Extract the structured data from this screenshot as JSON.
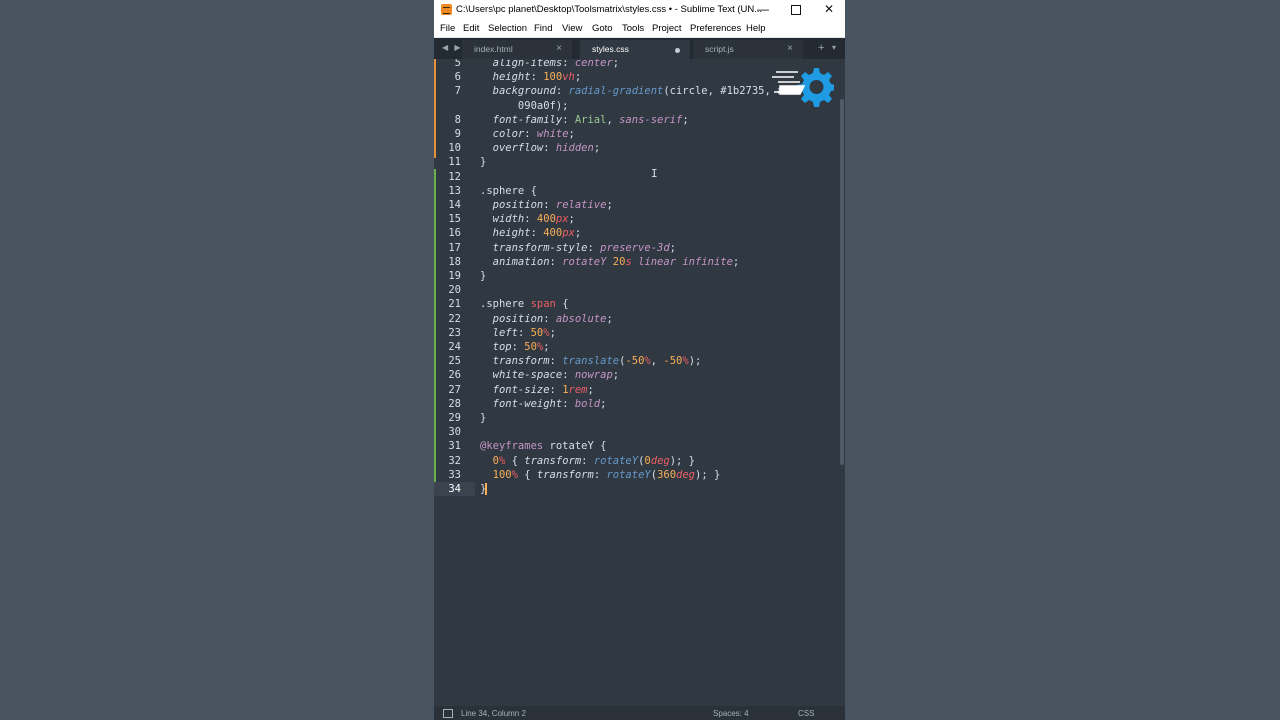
{
  "window": {
    "title": "C:\\Users\\pc planet\\Desktop\\Toolsmatrix\\styles.css • - Sublime Text (UN...",
    "controls": {
      "minimize": "—",
      "close": "✕"
    }
  },
  "menu": [
    "File",
    "Edit",
    "Selection",
    "Find",
    "View",
    "Goto",
    "Tools",
    "Project",
    "Preferences",
    "Help"
  ],
  "tabs": [
    {
      "label": "index.html",
      "active": false,
      "close": "×"
    },
    {
      "label": "styles.css",
      "active": true,
      "modified": true
    },
    {
      "label": "script.js",
      "active": false,
      "close": "×"
    }
  ],
  "tabbar": {
    "nav_arrows": "◀ ▶",
    "add": "+",
    "dropdown": "▾"
  },
  "editor": {
    "current_line": 34,
    "lines": [
      {
        "n": "5",
        "tokens": [
          [
            "prop",
            "  align-items"
          ],
          [
            "punc",
            ": "
          ],
          [
            "val",
            "center"
          ],
          [
            "punc",
            ";"
          ]
        ]
      },
      {
        "n": "6",
        "tokens": [
          [
            "prop",
            "  height"
          ],
          [
            "punc",
            ": "
          ],
          [
            "num",
            "100"
          ],
          [
            "unit",
            "vh"
          ],
          [
            "punc",
            ";"
          ]
        ]
      },
      {
        "n": "7",
        "tokens": [
          [
            "prop",
            "  background"
          ],
          [
            "punc",
            ": "
          ],
          [
            "fn",
            "radial-gradient"
          ],
          [
            "punc",
            "(circle, "
          ],
          [
            "hex",
            "#1b2735"
          ],
          [
            "punc",
            ", #"
          ]
        ]
      },
      {
        "n": "",
        "tokens": [
          [
            "hex",
            "      090a0f"
          ],
          [
            "punc",
            ");"
          ]
        ]
      },
      {
        "n": "8",
        "tokens": [
          [
            "prop",
            "  font-family"
          ],
          [
            "punc",
            ": "
          ],
          [
            "str",
            "Arial"
          ],
          [
            "punc",
            ", "
          ],
          [
            "val",
            "sans-serif"
          ],
          [
            "punc",
            ";"
          ]
        ]
      },
      {
        "n": "9",
        "tokens": [
          [
            "prop",
            "  color"
          ],
          [
            "punc",
            ": "
          ],
          [
            "val",
            "white"
          ],
          [
            "punc",
            ";"
          ]
        ]
      },
      {
        "n": "10",
        "tokens": [
          [
            "prop",
            "  overflow"
          ],
          [
            "punc",
            ": "
          ],
          [
            "val",
            "hidden"
          ],
          [
            "punc",
            ";"
          ]
        ]
      },
      {
        "n": "11",
        "tokens": [
          [
            "punc",
            "}"
          ]
        ]
      },
      {
        "n": "12",
        "tokens": []
      },
      {
        "n": "13",
        "tokens": [
          [
            "sel",
            ".sphere "
          ],
          [
            "punc",
            "{"
          ]
        ]
      },
      {
        "n": "14",
        "tokens": [
          [
            "prop",
            "  position"
          ],
          [
            "punc",
            ": "
          ],
          [
            "val",
            "relative"
          ],
          [
            "punc",
            ";"
          ]
        ]
      },
      {
        "n": "15",
        "tokens": [
          [
            "prop",
            "  width"
          ],
          [
            "punc",
            ": "
          ],
          [
            "num",
            "400"
          ],
          [
            "unit",
            "px"
          ],
          [
            "punc",
            ";"
          ]
        ]
      },
      {
        "n": "16",
        "tokens": [
          [
            "prop",
            "  height"
          ],
          [
            "punc",
            ": "
          ],
          [
            "num",
            "400"
          ],
          [
            "unit",
            "px"
          ],
          [
            "punc",
            ";"
          ]
        ]
      },
      {
        "n": "17",
        "tokens": [
          [
            "prop",
            "  transform-style"
          ],
          [
            "punc",
            ": "
          ],
          [
            "val",
            "preserve-3d"
          ],
          [
            "punc",
            ";"
          ]
        ]
      },
      {
        "n": "18",
        "tokens": [
          [
            "prop",
            "  animation"
          ],
          [
            "punc",
            ": "
          ],
          [
            "val",
            "rotateY "
          ],
          [
            "num",
            "20"
          ],
          [
            "unit",
            "s"
          ],
          [
            "val",
            " linear infinite"
          ],
          [
            "punc",
            ";"
          ]
        ]
      },
      {
        "n": "19",
        "tokens": [
          [
            "punc",
            "}"
          ]
        ]
      },
      {
        "n": "20",
        "tokens": []
      },
      {
        "n": "21",
        "tokens": [
          [
            "sel",
            ".sphere "
          ],
          [
            "tag",
            "span"
          ],
          [
            "punc",
            " {"
          ]
        ]
      },
      {
        "n": "22",
        "tokens": [
          [
            "prop",
            "  position"
          ],
          [
            "punc",
            ": "
          ],
          [
            "val",
            "absolute"
          ],
          [
            "punc",
            ";"
          ]
        ]
      },
      {
        "n": "23",
        "tokens": [
          [
            "prop",
            "  left"
          ],
          [
            "punc",
            ": "
          ],
          [
            "num",
            "50"
          ],
          [
            "unit",
            "%"
          ],
          [
            "punc",
            ";"
          ]
        ]
      },
      {
        "n": "24",
        "tokens": [
          [
            "prop",
            "  top"
          ],
          [
            "punc",
            ": "
          ],
          [
            "num",
            "50"
          ],
          [
            "unit",
            "%"
          ],
          [
            "punc",
            ";"
          ]
        ]
      },
      {
        "n": "25",
        "tokens": [
          [
            "prop",
            "  transform"
          ],
          [
            "punc",
            ": "
          ],
          [
            "fn",
            "translate"
          ],
          [
            "punc",
            "("
          ],
          [
            "num",
            "-50"
          ],
          [
            "unit",
            "%"
          ],
          [
            "punc",
            ", "
          ],
          [
            "num",
            "-50"
          ],
          [
            "unit",
            "%"
          ],
          [
            "punc",
            ");"
          ]
        ]
      },
      {
        "n": "26",
        "tokens": [
          [
            "prop",
            "  white-space"
          ],
          [
            "punc",
            ": "
          ],
          [
            "val",
            "nowrap"
          ],
          [
            "punc",
            ";"
          ]
        ]
      },
      {
        "n": "27",
        "tokens": [
          [
            "prop",
            "  font-size"
          ],
          [
            "punc",
            ": "
          ],
          [
            "num",
            "1"
          ],
          [
            "unit",
            "rem"
          ],
          [
            "punc",
            ";"
          ]
        ]
      },
      {
        "n": "28",
        "tokens": [
          [
            "prop",
            "  font-weight"
          ],
          [
            "punc",
            ": "
          ],
          [
            "val",
            "bold"
          ],
          [
            "punc",
            ";"
          ]
        ]
      },
      {
        "n": "29",
        "tokens": [
          [
            "punc",
            "}"
          ]
        ]
      },
      {
        "n": "30",
        "tokens": []
      },
      {
        "n": "31",
        "tokens": [
          [
            "at",
            "@keyframes"
          ],
          [
            "punc",
            " rotateY {"
          ]
        ]
      },
      {
        "n": "32",
        "tokens": [
          [
            "num",
            "  0"
          ],
          [
            "unit",
            "%"
          ],
          [
            "punc",
            " { "
          ],
          [
            "prop",
            "transform"
          ],
          [
            "punc",
            ": "
          ],
          [
            "fn",
            "rotateY"
          ],
          [
            "punc",
            "("
          ],
          [
            "num",
            "0"
          ],
          [
            "unit",
            "deg"
          ],
          [
            "punc",
            "); }"
          ]
        ]
      },
      {
        "n": "33",
        "tokens": [
          [
            "num",
            "  100"
          ],
          [
            "unit",
            "%"
          ],
          [
            "punc",
            " { "
          ],
          [
            "prop",
            "transform"
          ],
          [
            "punc",
            ": "
          ],
          [
            "fn",
            "rotateY"
          ],
          [
            "punc",
            "("
          ],
          [
            "num",
            "360"
          ],
          [
            "unit",
            "deg"
          ],
          [
            "punc",
            "); }"
          ]
        ]
      },
      {
        "n": "34",
        "tokens": [
          [
            "punc",
            "}"
          ]
        ]
      }
    ]
  },
  "status": {
    "position": "Line 34, Column 2",
    "indent": "Spaces: 4",
    "syntax": "CSS"
  },
  "colors": {
    "editor_bg": "#303841",
    "desktop_bg": "#495461",
    "accent_orange": "#f9ae58",
    "keyword_purple": "#c695c6",
    "function_blue": "#6699cc",
    "unit_red": "#ec5f67",
    "string_green": "#99c794",
    "logo_blue": "#1e9be3"
  },
  "logo": {
    "icon": "gear-icon"
  }
}
